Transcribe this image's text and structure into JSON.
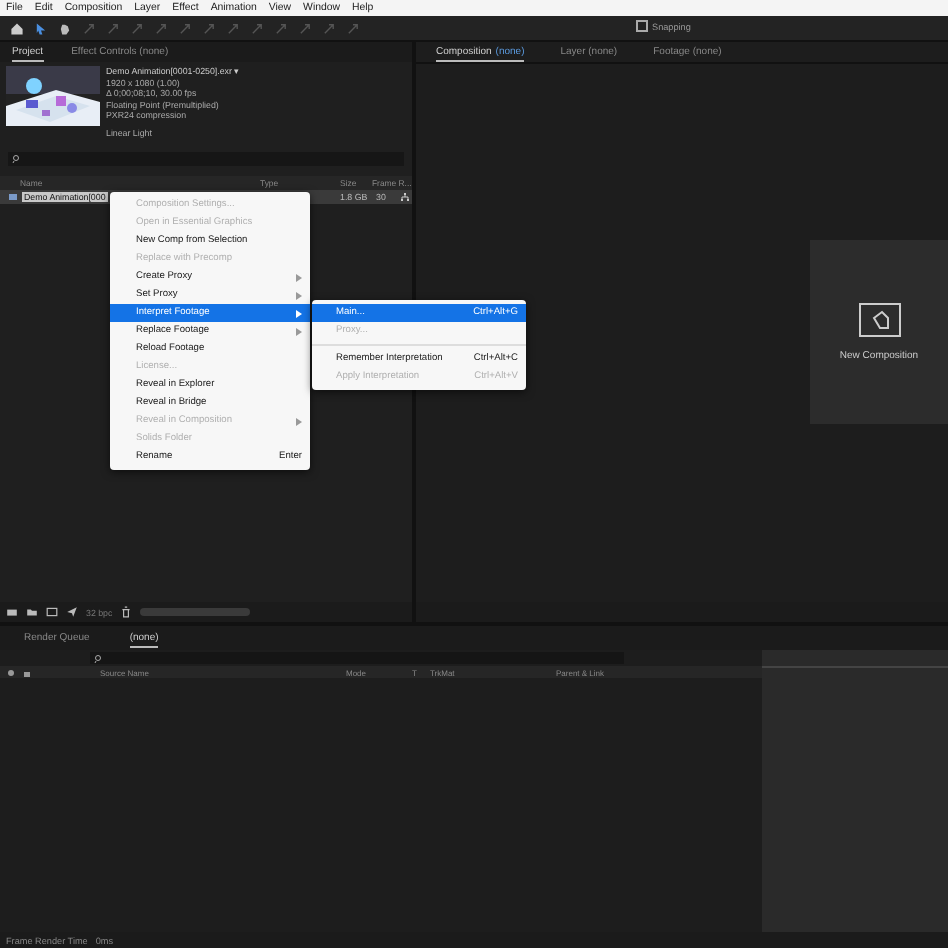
{
  "menubar": [
    "File",
    "Edit",
    "Composition",
    "Layer",
    "Effect",
    "Animation",
    "View",
    "Window",
    "Help"
  ],
  "project": {
    "tabs": [
      {
        "label": "Project",
        "selected": true
      },
      {
        "label": "Effect Controls (none)",
        "selected": false
      }
    ],
    "footage": {
      "name": "Demo Animation[0001-0250].exr ▾",
      "lines": [
        "1920 x 1080 (1.00)",
        "Δ 0;00;08;10, 30.00 fps",
        "Floating Point (Premultiplied)",
        "PXR24 compression"
      ],
      "note": "Linear Light"
    },
    "columns": [
      "Name",
      "Type",
      "Size",
      "Frame R..."
    ],
    "rows": [
      {
        "name": "Demo Animation[000",
        "size": "1.8 GB",
        "frame_rate": "30",
        "selected": true
      }
    ],
    "footer": {
      "bpc": "32 bpc"
    }
  },
  "context_menu": {
    "items": [
      {
        "label": "Composition Settings...",
        "disabled": true,
        "submenu": false,
        "selected": false
      },
      {
        "label": "Open in Essential Graphics",
        "disabled": true,
        "submenu": false,
        "selected": false
      },
      {
        "label": "New Comp from Selection",
        "disabled": false,
        "submenu": false,
        "selected": false
      },
      {
        "label": "Replace with Precomp",
        "disabled": true,
        "submenu": false,
        "selected": false
      },
      {
        "label": "Create Proxy",
        "disabled": false,
        "submenu": true,
        "selected": false
      },
      {
        "label": "Set Proxy",
        "disabled": false,
        "submenu": true,
        "selected": false
      },
      {
        "label": "Interpret Footage",
        "disabled": false,
        "submenu": true,
        "selected": true
      },
      {
        "label": "Replace Footage",
        "disabled": false,
        "submenu": true,
        "selected": false
      },
      {
        "label": "Reload Footage",
        "disabled": false,
        "submenu": false,
        "selected": false
      },
      {
        "label": "License...",
        "disabled": true,
        "submenu": false,
        "selected": false
      },
      {
        "label": "Reveal in Explorer",
        "disabled": false,
        "submenu": false,
        "selected": false
      },
      {
        "label": "Reveal in Bridge",
        "disabled": false,
        "submenu": false,
        "selected": false
      },
      {
        "label": "Reveal in Composition",
        "disabled": true,
        "submenu": true,
        "selected": false
      },
      {
        "label": "Solids Folder",
        "disabled": true,
        "submenu": false,
        "selected": false
      },
      {
        "label": "Rename",
        "disabled": false,
        "submenu": false,
        "selected": false,
        "shortcut": "Enter"
      }
    ]
  },
  "submenu": {
    "items": [
      {
        "kind": "item",
        "label": "Main...",
        "shortcut": "Ctrl+Alt+G",
        "disabled": false,
        "selected": true
      },
      {
        "kind": "item",
        "label": "Proxy...",
        "disabled": true,
        "selected": false
      },
      {
        "kind": "separator"
      },
      {
        "kind": "item",
        "label": "Remember Interpretation",
        "shortcut": "Ctrl+Alt+C",
        "disabled": false,
        "selected": false
      },
      {
        "kind": "item",
        "label": "Apply Interpretation",
        "shortcut": "Ctrl+Alt+V",
        "disabled": true,
        "selected": false
      }
    ]
  },
  "viewer": {
    "tabs": [
      {
        "label": "Composition",
        "suffix": "(none)",
        "selected": true
      },
      {
        "label": "Layer (none)",
        "selected": false
      },
      {
        "label": "Footage (none)",
        "selected": false
      }
    ],
    "snapping": {
      "label": "Snapping",
      "checked": false
    },
    "new_composition": {
      "label": "New Composition"
    }
  },
  "timeline": {
    "tabs": [
      {
        "label": "Render Queue",
        "selected": false
      },
      {
        "label": "(none)",
        "selected": true
      }
    ],
    "columns": [
      "Source Name",
      "Mode",
      "T",
      "TrkMat",
      "Parent & Link"
    ],
    "status": {
      "label": "Frame Render Time",
      "value": "0ms"
    }
  }
}
